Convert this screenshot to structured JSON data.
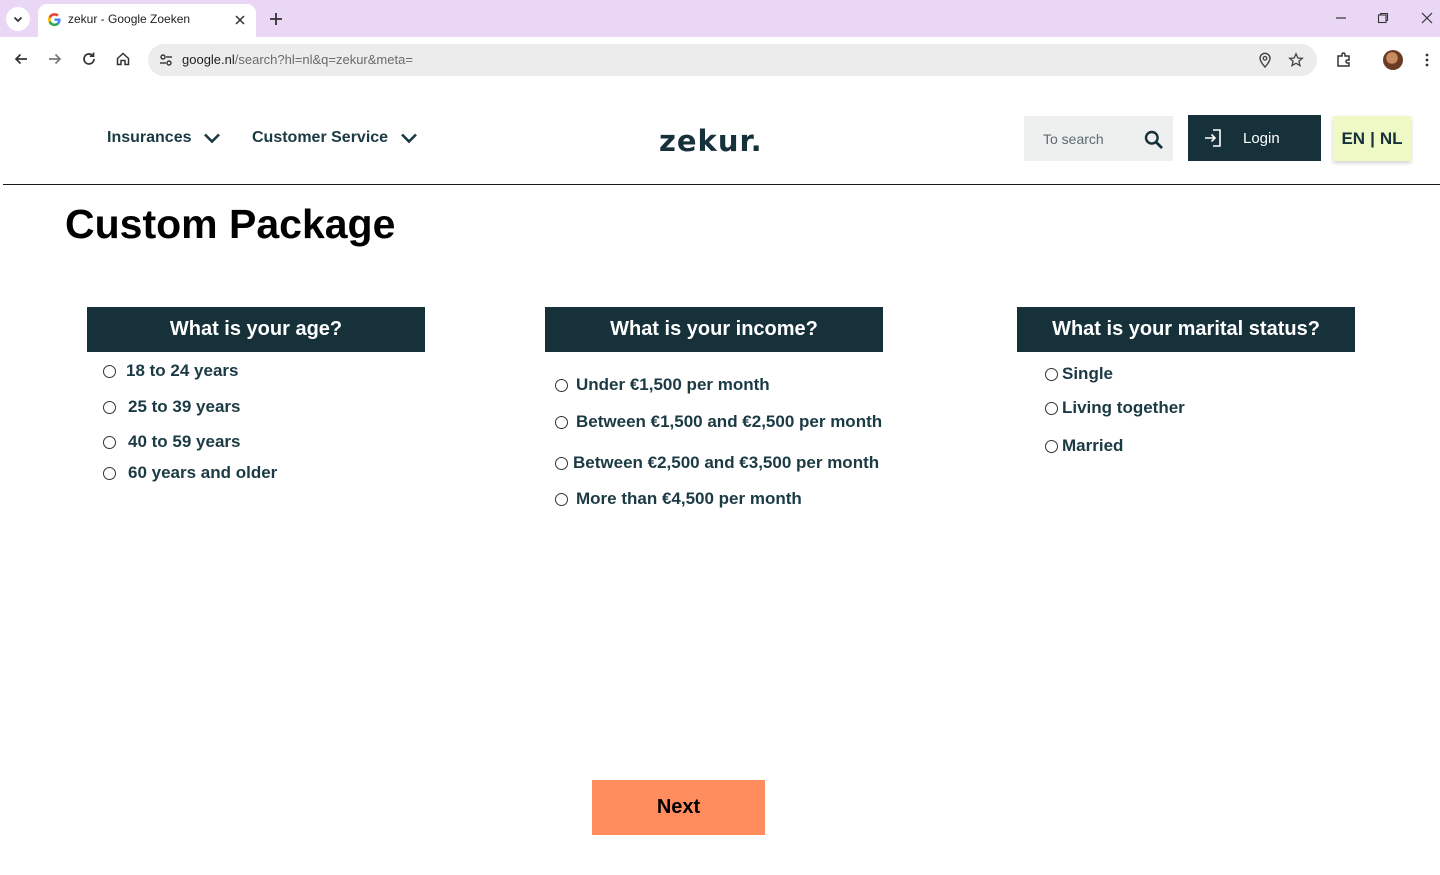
{
  "browser": {
    "tab_title": "zekur - Google Zoeken",
    "url_host": "google.nl",
    "url_rest": "/search?hl=nl&q=zekur&meta="
  },
  "header": {
    "nav": [
      {
        "label": "Insurances"
      },
      {
        "label": "Customer Service"
      }
    ],
    "logo": "zekur.",
    "search_placeholder": "To search",
    "login_label": "Login",
    "lang_en": "EN",
    "lang_sep": "|",
    "lang_nl": "NL"
  },
  "main": {
    "title": "Custom Package",
    "questions": [
      {
        "title": "What is your age?",
        "options": [
          "18 to 24 years",
          "25 to 39 years",
          "40 to 59 years",
          "60 years and older"
        ]
      },
      {
        "title": "What is your income?",
        "options": [
          "Under €1,500 per month",
          "Between €1,500 and €2,500 per month",
          "Between €2,500 and €3,500 per month",
          "More than €4,500 per month"
        ]
      },
      {
        "title": "What is your marital status?",
        "options": [
          "Single",
          "Living together",
          "Married"
        ]
      }
    ],
    "next_label": "Next"
  },
  "colors": {
    "brand_dark": "#17313a",
    "next_button": "#ff8d5e",
    "lang_button": "#eef9c6",
    "browser_tabbar": "#e9d7f5"
  }
}
